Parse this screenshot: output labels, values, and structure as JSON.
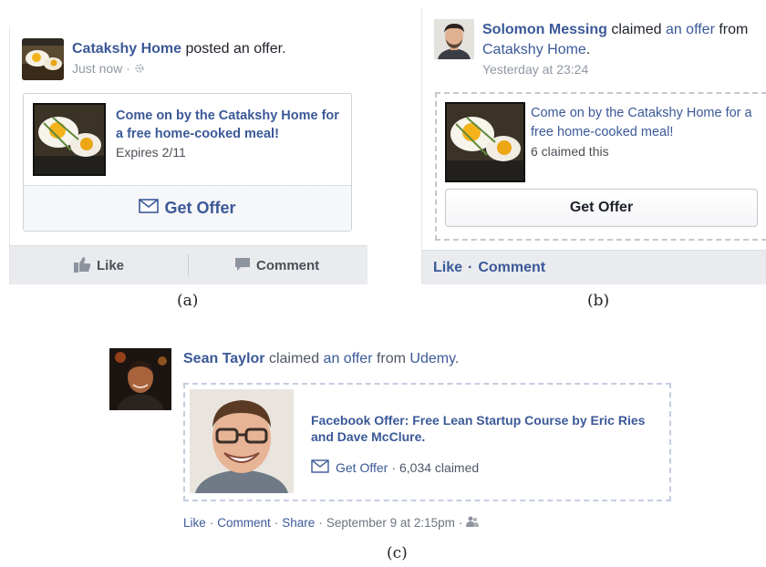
{
  "panel_a": {
    "poster_name": "Catakshy Home",
    "headline_rest": " posted an offer.",
    "timestamp": "Just now",
    "offer_title": "Come on by the Catakshy Home for a free home-cooked meal!",
    "offer_expiry": "Expires 2/11",
    "get_offer_label": "Get Offer",
    "like_label": "Like",
    "comment_label": "Comment",
    "caption": "(a)"
  },
  "panel_b": {
    "actor_name": "Solomon Messing",
    "claimed_text": " claimed ",
    "offer_link": "an offer",
    "from_text": " from ",
    "page_name": "Catakshy Home",
    "period": ".",
    "timestamp": "Yesterday at 23:24",
    "offer_title": "Come on by the Catakshy Home for a free home-cooked meal!",
    "claimed_count": "6 claimed this",
    "get_offer_label": "Get Offer",
    "like_label": "Like",
    "separator": "·",
    "comment_label": "Comment",
    "caption": "(b)"
  },
  "panel_c": {
    "actor_name": "Sean Taylor",
    "claimed_text": " claimed ",
    "offer_link": "an offer",
    "from_text": " from ",
    "page_name": "Udemy",
    "period": ".",
    "offer_title": "Facebook Offer: Free Lean Startup Course by Eric Ries and Dave McClure.",
    "get_offer_label": "Get Offer",
    "claimed_count": "6,034 claimed",
    "like_label": "Like",
    "comment_label": "Comment",
    "share_label": "Share",
    "timestamp": "September 9 at 2:15pm",
    "caption": "(c)"
  },
  "icons": {
    "gear": "gear-icon",
    "envelope": "envelope-icon",
    "thumbs_up": "thumbs-up-icon",
    "comment": "comment-bubble-icon",
    "friends": "friends-icon"
  },
  "colors": {
    "link_blue": "#3b5998",
    "action_bar": "#e9ebee",
    "muted_text": "#9197a3"
  }
}
